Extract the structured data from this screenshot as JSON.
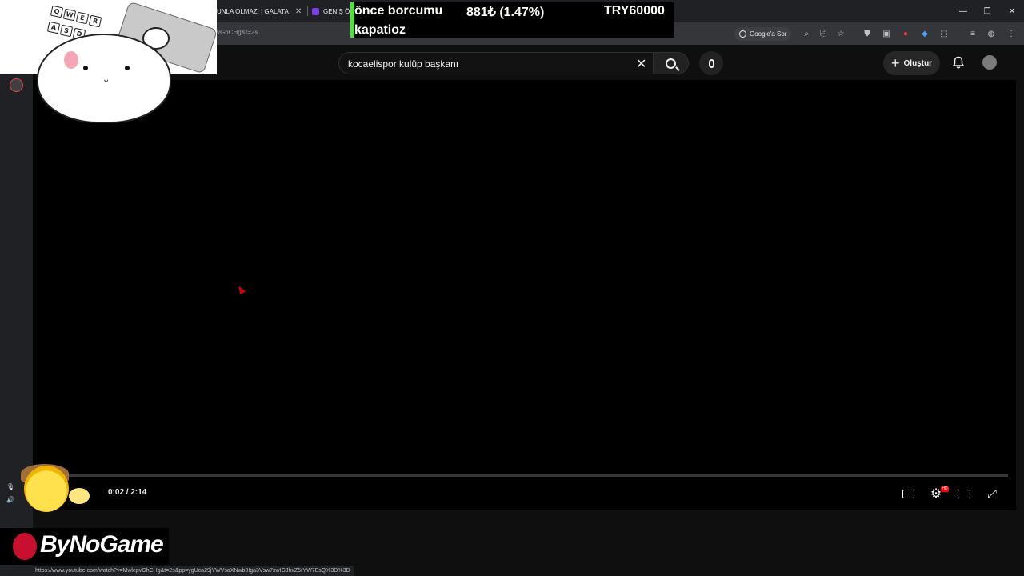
{
  "browser": {
    "tabs": [
      {
        "title": "UNLA OLMAZ! | GALATA"
      },
      {
        "title": "GENİŞ Ö"
      }
    ],
    "tab_close_glyph": "✕",
    "url_fragment": "vGhCHg&t=2s",
    "google_ask_label": "Google'a Sor",
    "window_controls": {
      "minimize": "—",
      "maximize": "❐",
      "close": "✕"
    },
    "status_url": "https://www.youtube.com/watch?v=MwlepvGhCHg&t=2s&pp=ygUca29jYWVsaXNwb3Iga3Vsw7xwIGJhxZ5rYW7EsQ%3D%3D"
  },
  "ticker": {
    "line1": "önce borcumu",
    "price": "881₺ (1.47%)",
    "amount": "TRY60000",
    "line2": "kapatioz",
    "accent_color": "#4fe33a"
  },
  "youtube": {
    "search_query": "kocaelispor kulüp başkanı",
    "create_label": "Oluştur",
    "icons": {
      "clear": "✕",
      "bell": "🔔",
      "plus": "+"
    }
  },
  "player": {
    "current_time": "0:02",
    "duration": "2:14",
    "time_display": "0:02 / 2:14",
    "progress_fraction": 0.016,
    "quality_badge": "HD",
    "accent_color": "#ff0000"
  },
  "overlays": {
    "sponsor_text": "ByNoGame",
    "keys": [
      "Q",
      "W",
      "E",
      "R",
      "A",
      "S",
      "D"
    ]
  }
}
